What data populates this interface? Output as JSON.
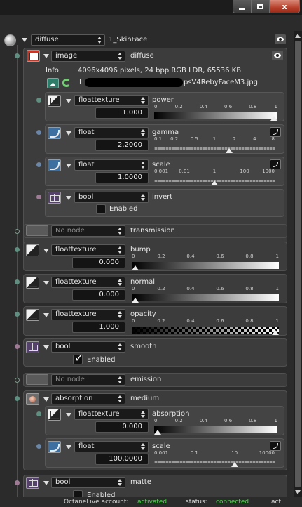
{
  "window": {
    "minimize_label": "",
    "maximize_label": "",
    "close_label": "x"
  },
  "root": {
    "type": "diffuse",
    "name": "1_SkinFace"
  },
  "diffuse": {
    "image_type": "image",
    "image_name": "diffuse",
    "info_label": "Info",
    "info_text": "4096x4096 pixels, 24 bpp RGB LDR, 65536 KB",
    "file_text": "psV4RebyFaceM3.jpg",
    "file_prefix": "L",
    "power": {
      "type": "floattexture",
      "name": "power",
      "value": "1.000",
      "ticks": [
        "0",
        "0.2",
        "0.4",
        "0.6",
        "0.8",
        "1"
      ],
      "fraction": 1.0
    },
    "gamma": {
      "type": "float",
      "name": "gamma",
      "value": "2.2000",
      "ticks": [
        "0.1",
        "0.2",
        "0.5",
        "1",
        "2",
        "4",
        "8"
      ],
      "fraction": 0.62
    },
    "scale": {
      "type": "float",
      "name": "scale",
      "value": "1.0000",
      "ticks": [
        "0.001",
        "0.01",
        "1",
        "100",
        "1000"
      ],
      "fraction": 0.5
    },
    "invert": {
      "type": "bool",
      "name": "invert",
      "enabled_label": "Enabled",
      "checked": false
    }
  },
  "transmission": {
    "type": "No node",
    "name": "transmission"
  },
  "bump": {
    "type": "floattexture",
    "name": "bump",
    "value": "0.000",
    "ticks": [
      "0",
      "0.2",
      "0.4",
      "0.6",
      "0.8",
      "1"
    ],
    "fraction": 0.0
  },
  "normal": {
    "type": "floattexture",
    "name": "normal",
    "value": "0.000",
    "ticks": [
      "0",
      "0.2",
      "0.4",
      "0.6",
      "0.8",
      "1"
    ],
    "fraction": 0.0
  },
  "opacity": {
    "type": "floattexture",
    "name": "opacity",
    "value": "1.000",
    "ticks": [
      "0",
      "0.2",
      "0.4",
      "0.6",
      "0.8",
      "1"
    ],
    "fraction": 1.0
  },
  "smooth": {
    "type": "bool",
    "name": "smooth",
    "enabled_label": "Enabled",
    "checked": true
  },
  "emission": {
    "type": "No node",
    "name": "emission"
  },
  "medium": {
    "type": "absorption",
    "name": "medium",
    "absorption": {
      "type": "floattexture",
      "name": "absorption",
      "value": "0.000",
      "ticks": [
        "0",
        "0.2",
        "0.4",
        "0.6",
        "0.8",
        "1"
      ],
      "fraction": 0.0
    },
    "scale": {
      "type": "float",
      "name": "scale",
      "value": "100.0000",
      "ticks": [
        "0.001",
        "0.1",
        "10",
        "10000"
      ],
      "fraction": 0.67
    }
  },
  "matte": {
    "type": "bool",
    "name": "matte",
    "enabled_label": "Enabled",
    "checked": false
  },
  "status": {
    "account_label": "OctaneLive account:",
    "account_value": "activated",
    "status_label": "status:",
    "status_value": "connected",
    "act_label": "act:"
  },
  "colors": {
    "background": "#2b2b2b",
    "status_ok": "#4cd64c",
    "close_button": "#b8412b"
  }
}
